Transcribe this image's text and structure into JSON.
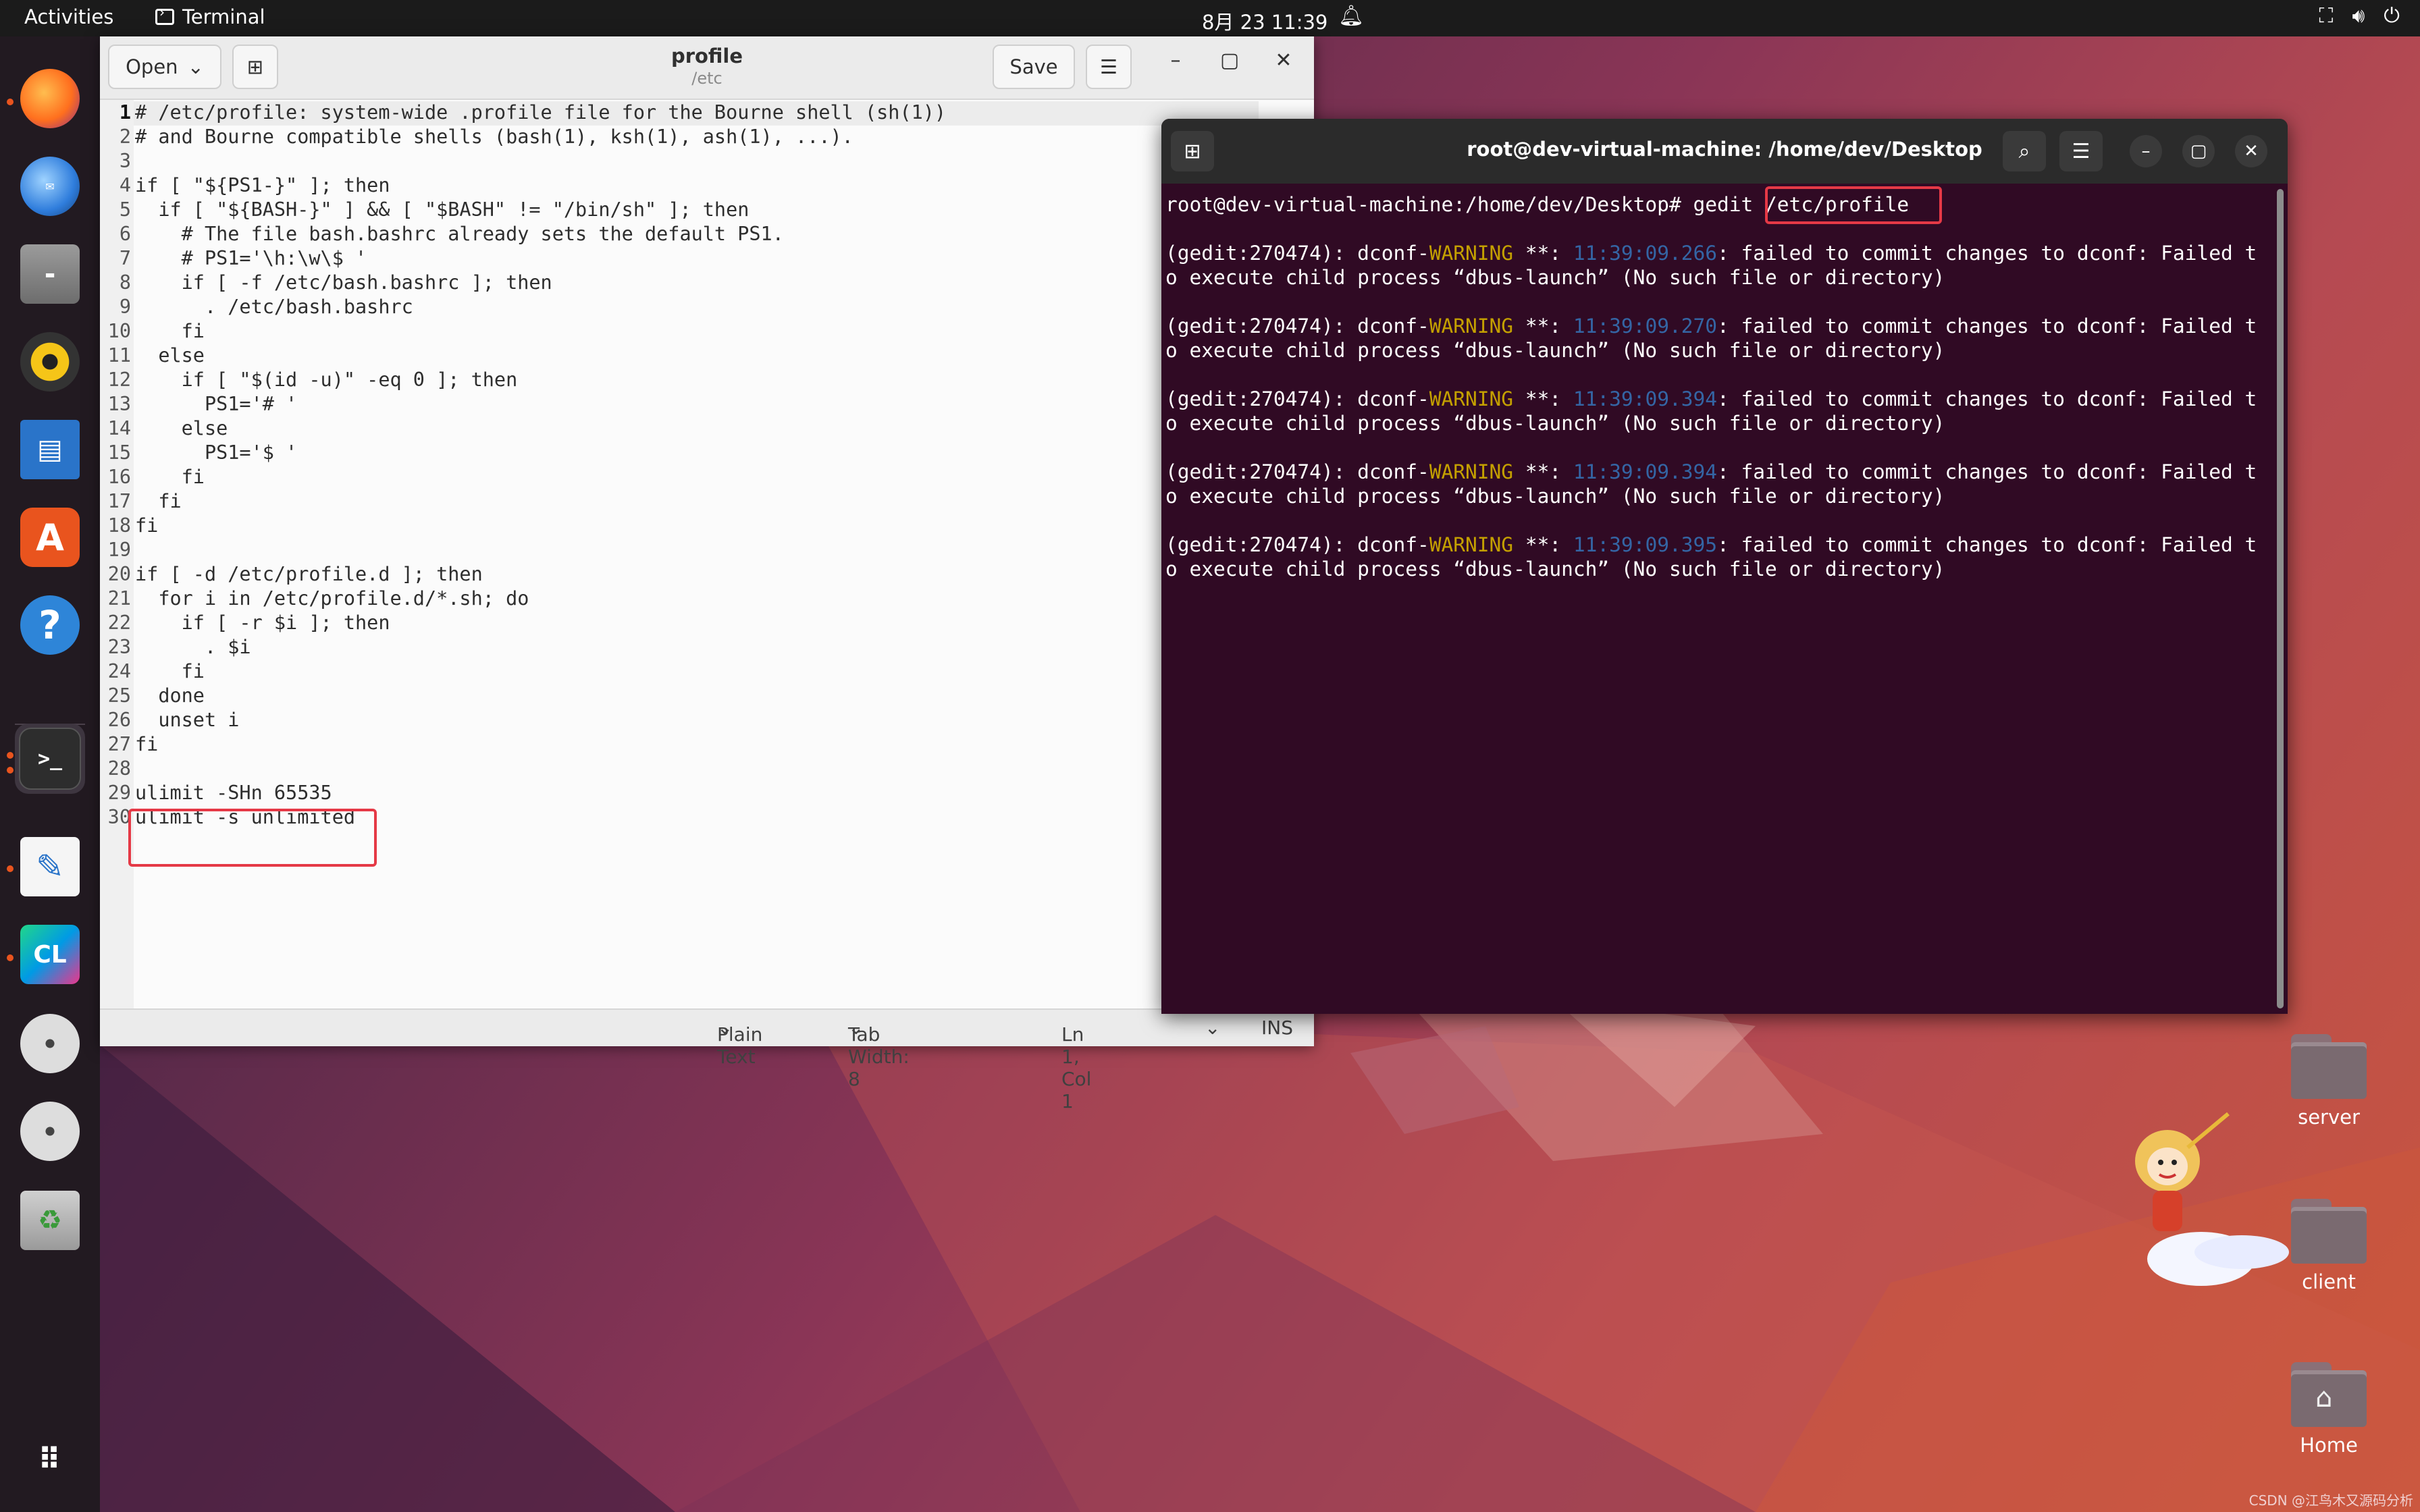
{
  "topbar": {
    "activities": "Activities",
    "app_name": "Terminal",
    "clock": "8月 23  11:39"
  },
  "dock": {
    "apps": [
      "firefox",
      "thunderbird",
      "files",
      "rhythmbox",
      "libreoffice-writer",
      "app-center",
      "help",
      "terminal",
      "text-editor",
      "clion",
      "dvd-drive",
      "dvd-drive",
      "trash",
      "show-apps"
    ]
  },
  "gedit": {
    "open_label": "Open",
    "save_label": "Save",
    "title": "profile",
    "subtitle": "/etc",
    "lines": [
      "# /etc/profile: system-wide .profile file for the Bourne shell (sh(1))",
      "# and Bourne compatible shells (bash(1), ksh(1), ash(1), ...).",
      "",
      "if [ \"${PS1-}\" ]; then",
      "  if [ \"${BASH-}\" ] && [ \"$BASH\" != \"/bin/sh\" ]; then",
      "    # The file bash.bashrc already sets the default PS1.",
      "    # PS1='\\h:\\w\\$ '",
      "    if [ -f /etc/bash.bashrc ]; then",
      "      . /etc/bash.bashrc",
      "    fi",
      "  else",
      "    if [ \"$(id -u)\" -eq 0 ]; then",
      "      PS1='# '",
      "    else",
      "      PS1='$ '",
      "    fi",
      "  fi",
      "fi",
      "",
      "if [ -d /etc/profile.d ]; then",
      "  for i in /etc/profile.d/*.sh; do",
      "    if [ -r $i ]; then",
      "      . $i",
      "    fi",
      "  done",
      "  unset i",
      "fi",
      "",
      "ulimit -SHn 65535",
      "ulimit -s unlimited"
    ],
    "status": {
      "language": "Plain Text",
      "tab_width": "Tab Width: 8",
      "position": "Ln 1, Col 1",
      "mode": "INS"
    }
  },
  "terminal": {
    "title": "root@dev-virtual-machine: /home/dev/Desktop",
    "prompt": "root@dev-virtual-machine:/home/dev/Desktop# gedit ",
    "command_arg": "/etc/profile",
    "warnings": [
      {
        "prefix": "(gedit:270474): dconf-",
        "level": "WARNING",
        "mid": " **: ",
        "time": "11:39:09.266",
        "msg": ": failed to commit changes to dconf: Failed t",
        "cont": "o execute child process “dbus-launch” (No such file or directory)"
      },
      {
        "prefix": "(gedit:270474): dconf-",
        "level": "WARNING",
        "mid": " **: ",
        "time": "11:39:09.270",
        "msg": ": failed to commit changes to dconf: Failed t",
        "cont": "o execute child process “dbus-launch” (No such file or directory)"
      },
      {
        "prefix": "(gedit:270474): dconf-",
        "level": "WARNING",
        "mid": " **: ",
        "time": "11:39:09.394",
        "msg": ": failed to commit changes to dconf: Failed t",
        "cont": "o execute child process “dbus-launch” (No such file or directory)"
      },
      {
        "prefix": "(gedit:270474): dconf-",
        "level": "WARNING",
        "mid": " **: ",
        "time": "11:39:09.394",
        "msg": ": failed to commit changes to dconf: Failed t",
        "cont": "o execute child process “dbus-launch” (No such file or directory)"
      },
      {
        "prefix": "(gedit:270474): dconf-",
        "level": "WARNING",
        "mid": " **: ",
        "time": "11:39:09.395",
        "msg": ": failed to commit changes to dconf: Failed t",
        "cont": "o execute child process “dbus-launch” (No such file or directory)"
      }
    ]
  },
  "desktop": {
    "icons": [
      {
        "label": "server"
      },
      {
        "label": "client"
      },
      {
        "label": "Home"
      }
    ]
  },
  "watermark": "CSDN @江鸟木又源码分析",
  "colors": {
    "highlight": "#e53946",
    "terminal_bg": "#300a24",
    "warning": "#c4a000",
    "timestamp": "#3465a4",
    "ubuntu_orange": "#e9541e"
  }
}
